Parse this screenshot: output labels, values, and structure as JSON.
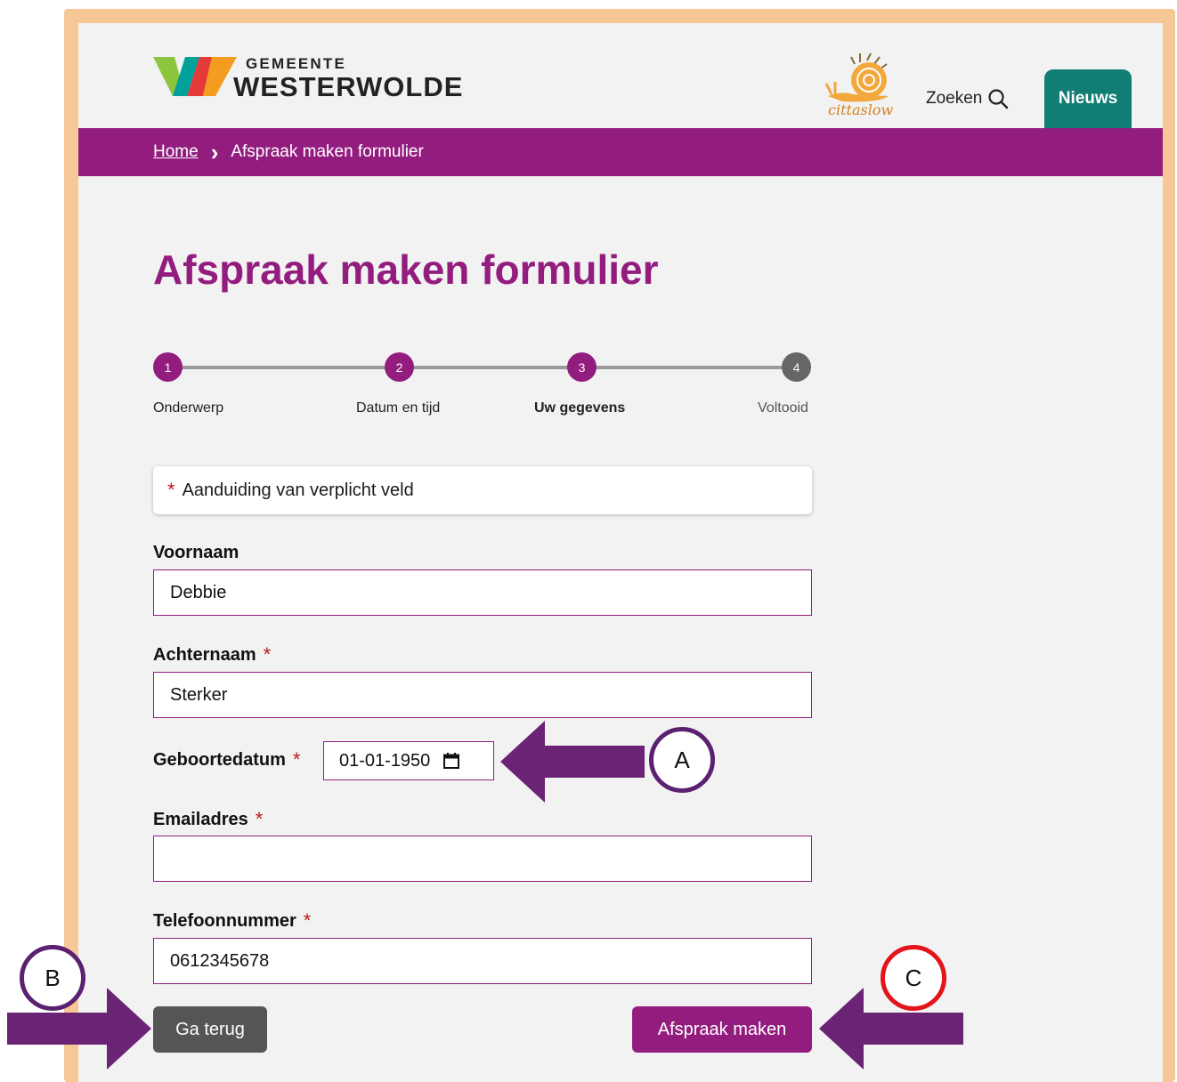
{
  "colors": {
    "brand_purple": "#931d7f",
    "teal": "#127d74",
    "frame": "#f5c895",
    "required_red": "#c4161c",
    "annotation_purple": "#5b2170",
    "annotation_red": "#e3141b"
  },
  "header": {
    "logo_top": "GEMEENTE",
    "logo_main": "WESTERWOLDE",
    "cittaslow_text": "cittaslow",
    "search_label": "Zoeken",
    "search_icon": "search-icon",
    "news_label": "Nieuws"
  },
  "breadcrumb": {
    "home": "Home",
    "separator": "›",
    "current": "Afspraak maken formulier"
  },
  "page_title": "Afspraak maken formulier",
  "steps": [
    {
      "number": "1",
      "label": "Onderwerp",
      "state": "done"
    },
    {
      "number": "2",
      "label": "Datum en tijd",
      "state": "done"
    },
    {
      "number": "3",
      "label": "Uw gegevens",
      "state": "current"
    },
    {
      "number": "4",
      "label": "Voltooid",
      "state": "todo"
    }
  ],
  "notice": {
    "star": "*",
    "text": "Aanduiding van verplicht veld"
  },
  "form": {
    "required_mark": "*",
    "first_name": {
      "label": "Voornaam",
      "value": "Debbie",
      "required": false
    },
    "last_name": {
      "label": "Achternaam",
      "value": "Sterker",
      "required": true
    },
    "birth_date": {
      "label": "Geboortedatum",
      "value": "01-01-1950",
      "required": true,
      "icon": "calendar-icon"
    },
    "email": {
      "label": "Emailadres",
      "value": "",
      "required": true
    },
    "phone": {
      "label": "Telefoonnummer",
      "value": "0612345678",
      "required": true
    }
  },
  "buttons": {
    "back": "Ga terug",
    "submit": "Afspraak maken"
  },
  "annotations": {
    "a": "A",
    "b": "B",
    "c": "C"
  }
}
